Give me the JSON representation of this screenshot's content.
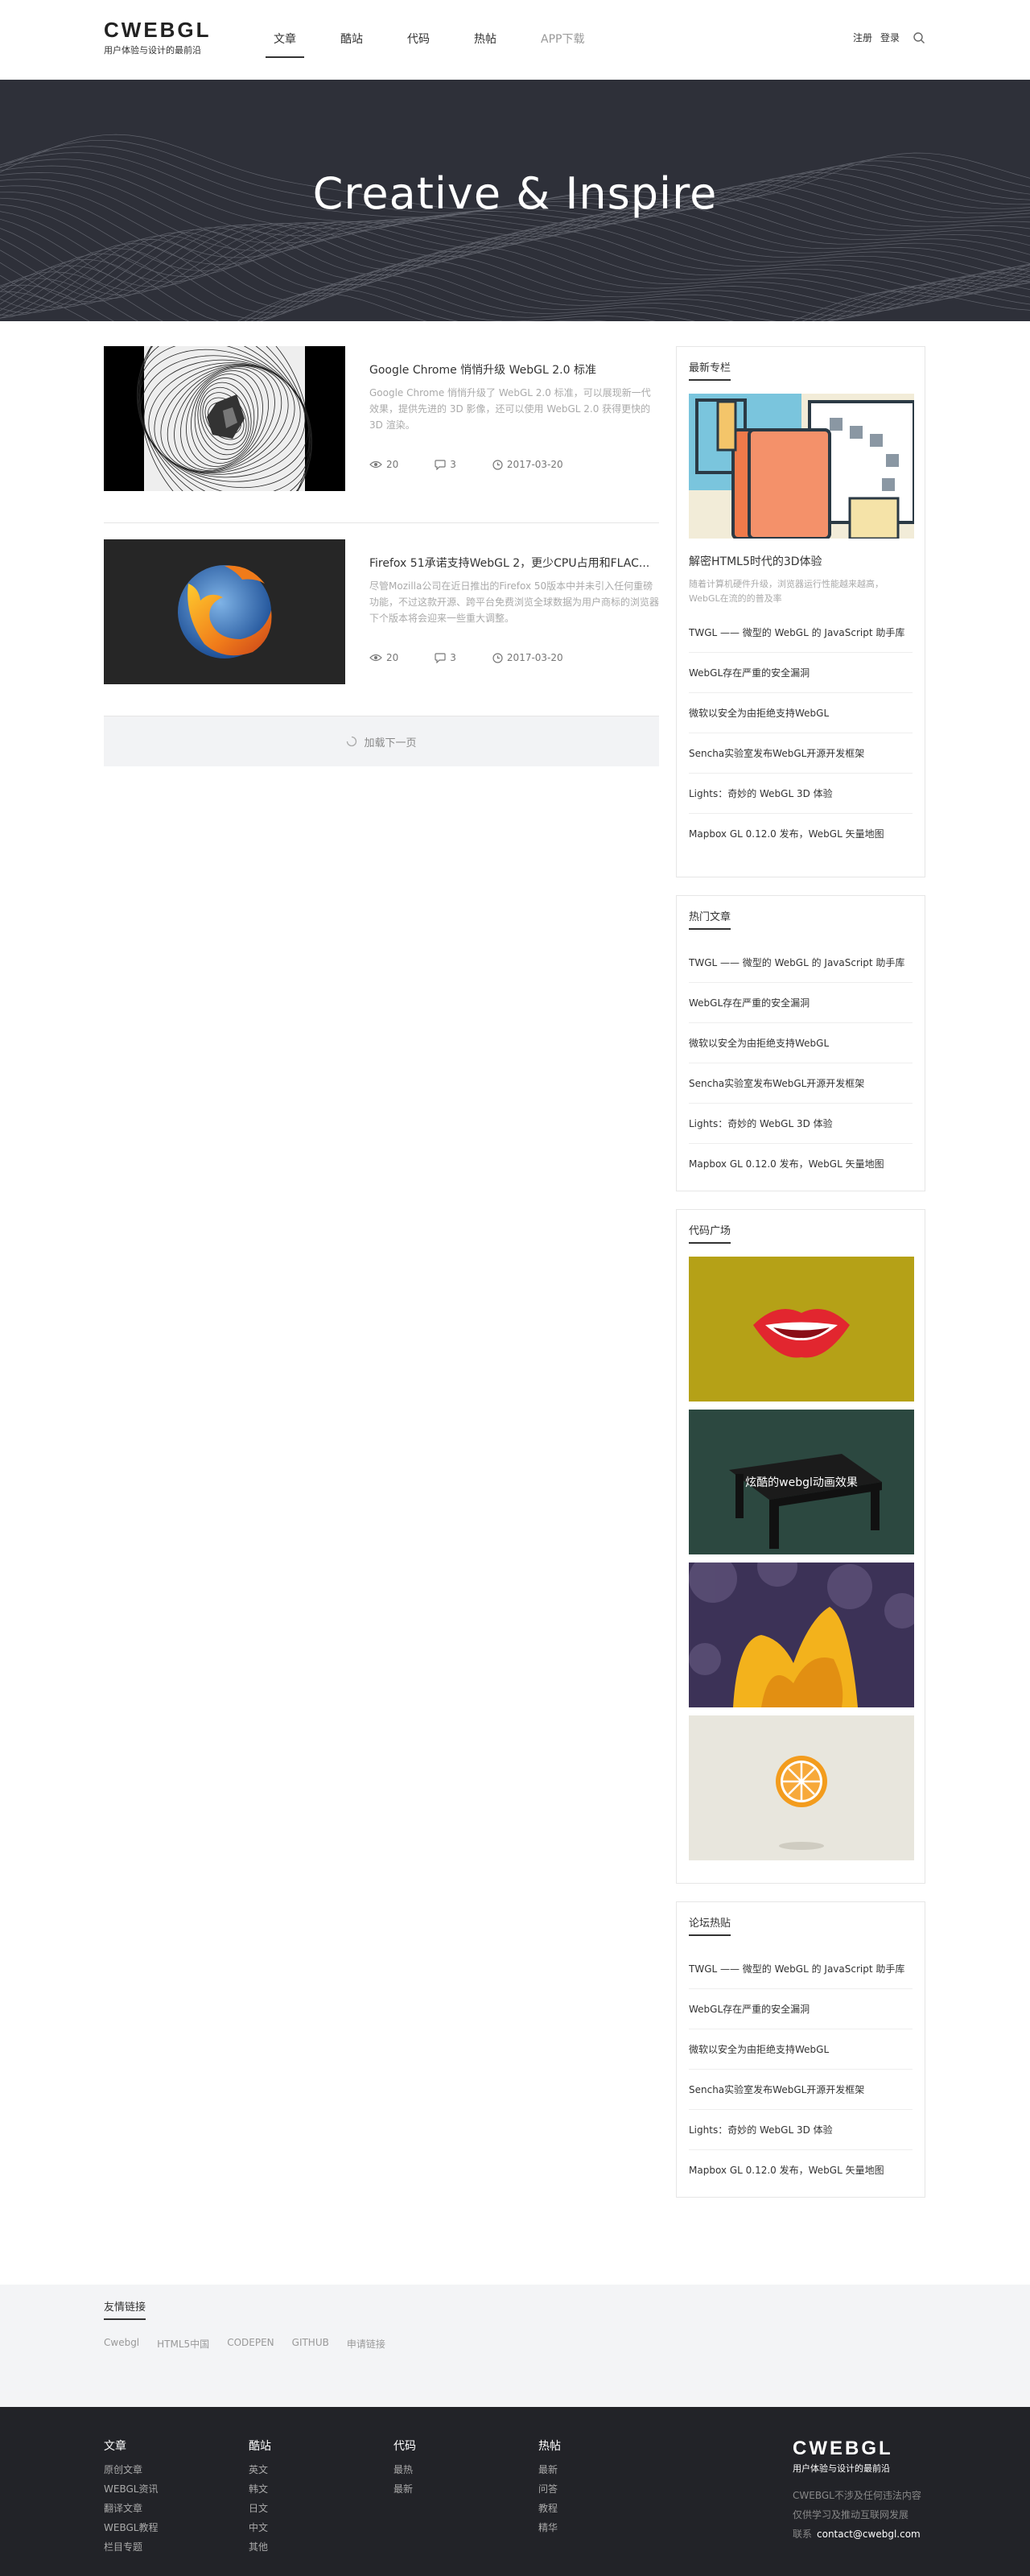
{
  "header": {
    "logo": "CWEBGL",
    "tagline": "用户体验与设计的最前沿",
    "nav": [
      "文章",
      "酷站",
      "代码",
      "热帖",
      "APP下载"
    ],
    "register": "注册",
    "login": "登录"
  },
  "banner": {
    "title": "Creative & Inspire"
  },
  "posts": [
    {
      "title": "Google Chrome 悄悄升级 WebGL 2.0 标准",
      "excerpt": "Google Chrome 悄悄升级了 WebGL 2.0 标准，可以展现新一代效果，提供先进的 3D 影像，还可以使用 WebGL 2.0 获得更快的 3D 渲染。",
      "views": "20",
      "comments": "3",
      "date": "2017-03-20"
    },
    {
      "title": "Firefox 51承诺支持WebGL 2，更少CPU占用和FLAC...",
      "excerpt": "尽管Mozilla公司在近日推出的Firefox 50版本中并未引入任何重磅功能，不过这款开源、跨平台免费浏览全球数据为用户商标的浏览器下个版本将会迎来一些重大调整。",
      "views": "20",
      "comments": "3",
      "date": "2017-03-20"
    }
  ],
  "load_more": "加载下一页",
  "sidebar": {
    "featured": {
      "title": "最新专栏",
      "article_title": "解密HTML5时代的3D体验",
      "article_desc": "随着计算机硬件升级，浏览器运行性能越来越高，WebGL在流的的普及率",
      "items": [
        "TWGL —— 微型的 WebGL 的 JavaScript 助手库",
        "WebGL存在严重的安全漏洞",
        "微软以安全为由拒绝支持WebGL",
        "Sencha实验室发布WebGL开源开发框架",
        "Lights：奇妙的 WebGL 3D 体验",
        "Mapbox GL 0.12.0 发布，WebGL 矢量地图"
      ]
    },
    "hot": {
      "title": "热门文章",
      "items": [
        "TWGL —— 微型的 WebGL 的 JavaScript 助手库",
        "WebGL存在严重的安全漏洞",
        "微软以安全为由拒绝支持WebGL",
        "Sencha实验室发布WebGL开源开发框架",
        "Lights：奇妙的 WebGL 3D 体验",
        "Mapbox GL 0.12.0 发布，WebGL 矢量地图"
      ]
    },
    "code": {
      "title": "代码广场",
      "tile2_caption": "炫酷的webgl动画效果"
    },
    "forum": {
      "title": "论坛热贴",
      "items": [
        "TWGL —— 微型的 WebGL 的 JavaScript 助手库",
        "WebGL存在严重的安全漏洞",
        "微软以安全为由拒绝支持WebGL",
        "Sencha实验室发布WebGL开源开发框架",
        "Lights：奇妙的 WebGL 3D 体验",
        "Mapbox GL 0.12.0 发布，WebGL 矢量地图"
      ]
    }
  },
  "links": {
    "title": "友情链接",
    "items": [
      "Cwebgl",
      "HTML5中国",
      "CODEPEN",
      "GITHUB",
      "申请链接"
    ]
  },
  "footer": {
    "cols": [
      {
        "title": "文章",
        "items": [
          "原创文章",
          "WEBGL资讯",
          "翻译文章",
          "WEBGL教程",
          "栏目专题"
        ]
      },
      {
        "title": "酷站",
        "items": [
          "英文",
          "韩文",
          "日文",
          "中文",
          "其他"
        ]
      },
      {
        "title": "代码",
        "items": [
          "最热",
          "最新"
        ]
      },
      {
        "title": "热帖",
        "items": [
          "最新",
          "问答",
          "教程",
          "精华"
        ]
      }
    ],
    "logo": "CWEBGL",
    "tagline": "用户体验与设计的最前沿",
    "text1": "CWEBGL不涉及任何违法内容",
    "text2": "仅供学习及推动互联网发展",
    "contact_label": "联系",
    "contact_email": "contact@cwebgl.com"
  }
}
